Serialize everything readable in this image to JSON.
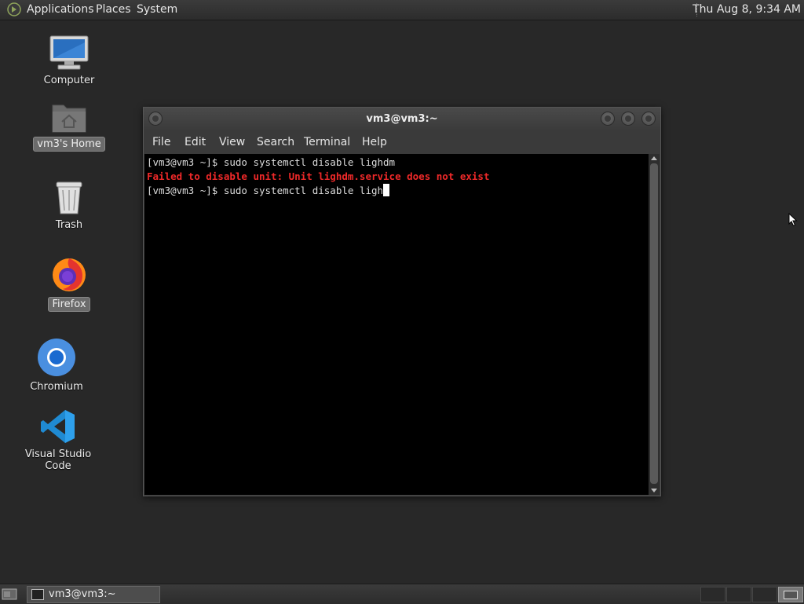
{
  "top_panel": {
    "applications": "Applications",
    "places": "Places",
    "system": "System",
    "clock": "Thu Aug  8,  9:34 AM"
  },
  "desktop": {
    "icons": [
      {
        "label": "Computer"
      },
      {
        "label": "vm3's Home"
      },
      {
        "label": "Trash"
      },
      {
        "label": "Firefox"
      },
      {
        "label": "Chromium"
      },
      {
        "label": "Visual Studio Code"
      }
    ]
  },
  "terminal": {
    "title": "vm3@vm3:~",
    "menu": [
      "File",
      "Edit",
      "View",
      "Search",
      "Terminal",
      "Help"
    ],
    "lines": [
      "[vm3@vm3 ~]$ sudo systemctl disable lighdm",
      "Failed to disable unit: Unit lighdm.service does not exist",
      "[vm3@vm3 ~]$ sudo systemctl disable ligh"
    ]
  },
  "taskbar": {
    "task_label": "vm3@vm3:~"
  },
  "colors": {
    "error_text": "#ef2929",
    "desktop_bg": "#282828",
    "terminal_bg": "#000000"
  }
}
